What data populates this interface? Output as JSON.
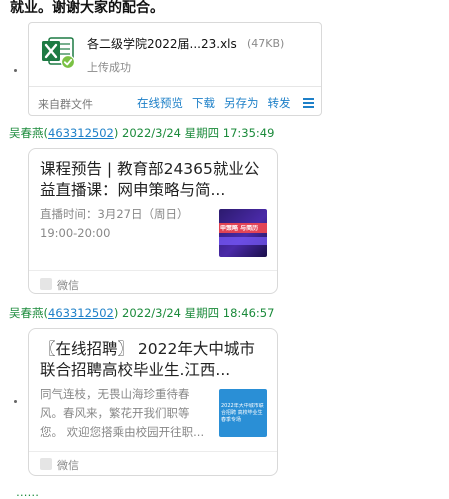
{
  "message_top": {
    "text": "就业。谢谢大家的配合。"
  },
  "file_card": {
    "icon": "excel-file-icon",
    "file_name": "各二级学院2022届...23.xls",
    "file_size": "(47KB)",
    "status": "上传成功",
    "source": "来自群文件",
    "actions": [
      "在线预览",
      "下载",
      "另存为",
      "转发"
    ],
    "colors": {
      "link": "#1e80c8",
      "excel_green": "#1d7a43"
    }
  },
  "messages": [
    {
      "sender_name": "吴春燕",
      "sender_qq": "463312502",
      "timestamp": "2022/3/24 星期四 17:35:49",
      "card": {
        "title": "课程预告 | 教育部24365就业公益直播课：网申策略与简...",
        "description": "直播时间：3月27日（周日）19:00-20:00",
        "thumb_text": "申策略 与简历",
        "source": "微信"
      }
    },
    {
      "sender_name": "吴春燕",
      "sender_qq": "463312502",
      "timestamp": "2022/3/24 星期四 18:46:57",
      "card": {
        "title": "〖在线招聘〗 2022年大中城市联合招聘高校毕业生.江西...",
        "description": "同气连枝，无畏山海珍重待春风。春风来，繁花开我们职等您。 欢迎您搭乘由校园开往职...",
        "thumb_text": "2022年大中城市联合招聘 高校毕业生春季专场",
        "source": "微信"
      }
    }
  ],
  "bottom_partial": "……"
}
